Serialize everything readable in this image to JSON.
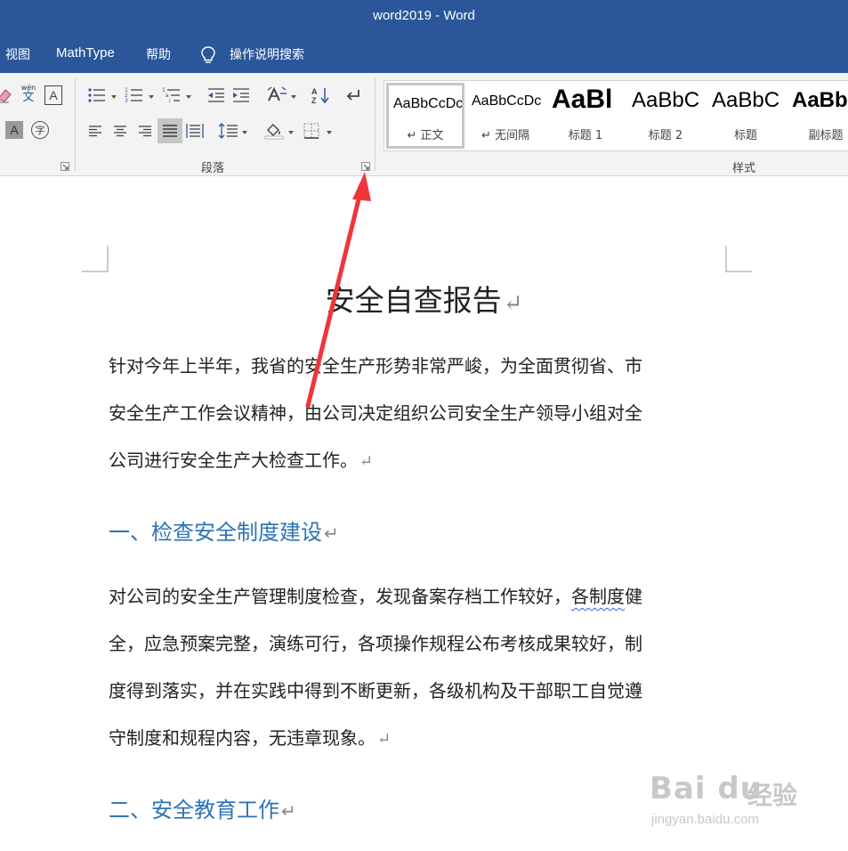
{
  "window": {
    "title": "word2019  -  Word"
  },
  "tabs": [
    {
      "label": "视图"
    },
    {
      "label": "MathType"
    },
    {
      "label": "帮助"
    },
    {
      "label": "操作说明搜索"
    }
  ],
  "ribbon": {
    "paragraph_group_label": "段落",
    "styles_group_label": "样式",
    "phonetic_guide": {
      "top": "wén",
      "bottom": "文"
    },
    "char_border_glyph": "A",
    "char_shading_glyph": "A",
    "enclose_glyph": "字",
    "styles": [
      {
        "sample": "AaBbCcDc",
        "name": "↵ 正文",
        "active": true
      },
      {
        "sample": "AaBbCcDc",
        "name": "↵ 无间隔",
        "active": false
      },
      {
        "sample": "AaBl",
        "name": "标题 1",
        "active": false
      },
      {
        "sample": "AaBbC",
        "name": "标题 2",
        "active": false
      },
      {
        "sample": "AaBbC",
        "name": "标题",
        "active": false
      },
      {
        "sample": "AaBb",
        "name": "副标题",
        "active": false
      }
    ]
  },
  "document": {
    "title": "安全自查报告",
    "para1": [
      "针对今年上半年，我省的安全生产形势非常严峻，为全面贯彻省、市",
      "安全生产工作会议精神，由公司决定组织公司安全生产领导小组对全",
      "公司进行安全生产大检查工作。"
    ],
    "heading1": "一、检查安全制度建设",
    "para2": {
      "line1_before": "对公司的安全生产管理制度检查，发现备案存档工作较好，",
      "line1_squiggle": "各制度",
      "line1_after": "健",
      "line2": "全，应急预案完整，演练可行，各项操作规程公布考核成果较好，制",
      "line3": "度得到落实，并在实践中得到不断更新，各级机构及干部职工自觉遵",
      "line4": "守制度和规程内容，无违章现象。"
    },
    "heading2": "二、安全教育工作",
    "paragraph_mark": "↵"
  },
  "watermark": {
    "brand": "Bai du",
    "cn": "经验",
    "url": "jingyan.baidu.com"
  },
  "colors": {
    "title_bar": "#2b579a",
    "heading": "#2e74b5",
    "arrow": "#f0353a",
    "ribbon_bg": "#f3f3f3"
  }
}
